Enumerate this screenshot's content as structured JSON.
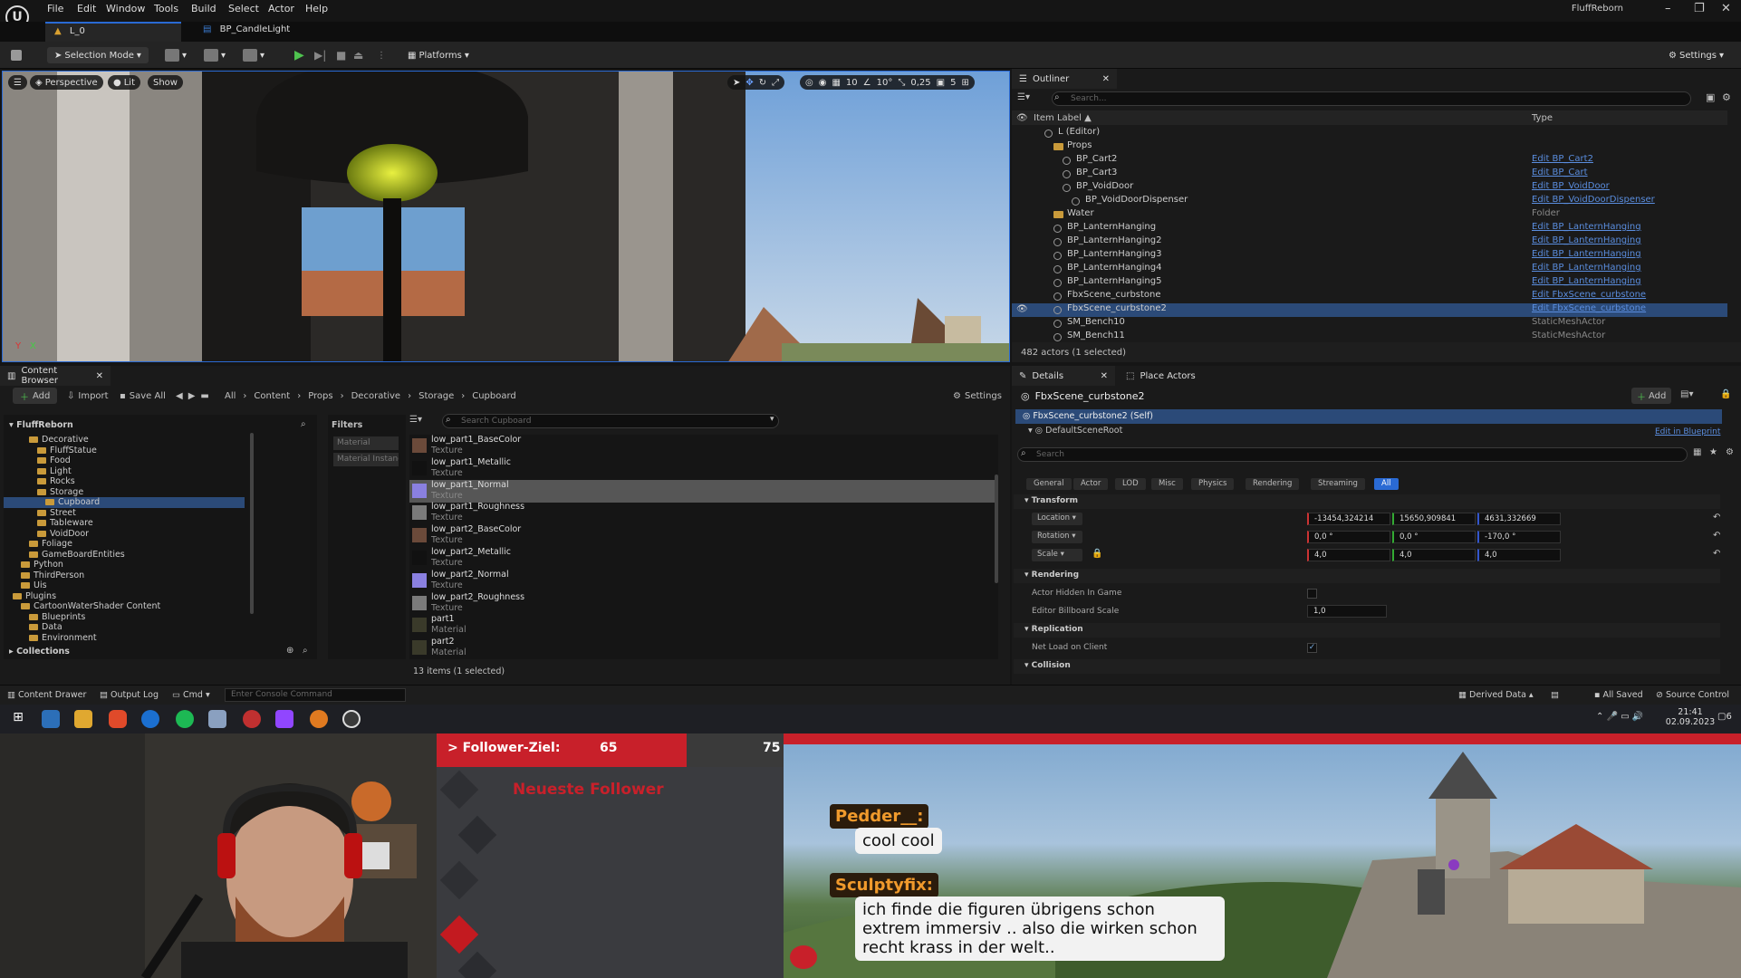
{
  "menubar": {
    "items": [
      "File",
      "Edit",
      "Window",
      "Tools",
      "Build",
      "Select",
      "Actor",
      "Help"
    ],
    "app_name": "FluffReborn"
  },
  "tabs": {
    "level": "L_0",
    "blueprint": "BP_CandleLight"
  },
  "toolbar": {
    "selection_mode": "Selection Mode",
    "platforms": "Platforms",
    "settings": "Settings"
  },
  "viewport": {
    "perspective": "Perspective",
    "lit": "Lit",
    "show": "Show",
    "grid_snap": "10",
    "rot_snap": "10°",
    "scale_snap": "0,25",
    "cam_speed": "5"
  },
  "outliner": {
    "tab": "Outliner",
    "search_placeholder": "Search...",
    "col_label": "Item Label ▲",
    "col_type": "Type",
    "rows": [
      {
        "label": "L (Editor)",
        "type": "",
        "indent": 2,
        "kind": "level"
      },
      {
        "label": "Props",
        "type": "",
        "indent": 3,
        "kind": "folder"
      },
      {
        "label": "BP_Cart2",
        "type": "Edit BP_Cart2",
        "indent": 4,
        "kind": "actor"
      },
      {
        "label": "BP_Cart3",
        "type": "Edit BP_Cart",
        "indent": 4,
        "kind": "actor"
      },
      {
        "label": "BP_VoidDoor",
        "type": "Edit BP_VoidDoor",
        "indent": 4,
        "kind": "actor"
      },
      {
        "label": "BP_VoidDoorDispenser",
        "type": "Edit BP_VoidDoorDispenser",
        "indent": 5,
        "kind": "actor"
      },
      {
        "label": "Water",
        "type": "Folder",
        "indent": 3,
        "kind": "folder"
      },
      {
        "label": "BP_LanternHanging",
        "type": "Edit BP_LanternHanging",
        "indent": 3,
        "kind": "actor"
      },
      {
        "label": "BP_LanternHanging2",
        "type": "Edit BP_LanternHanging",
        "indent": 3,
        "kind": "actor"
      },
      {
        "label": "BP_LanternHanging3",
        "type": "Edit BP_LanternHanging",
        "indent": 3,
        "kind": "actor"
      },
      {
        "label": "BP_LanternHanging4",
        "type": "Edit BP_LanternHanging",
        "indent": 3,
        "kind": "actor"
      },
      {
        "label": "BP_LanternHanging5",
        "type": "Edit BP_LanternHanging",
        "indent": 3,
        "kind": "actor"
      },
      {
        "label": "FbxScene_curbstone",
        "type": "Edit FbxScene_curbstone",
        "indent": 3,
        "kind": "actor"
      },
      {
        "label": "FbxScene_curbstone2",
        "type": "Edit FbxScene_curbstone",
        "indent": 3,
        "kind": "actor",
        "selected": true
      },
      {
        "label": "SM_Bench10",
        "type": "StaticMeshActor",
        "indent": 3,
        "kind": "actor"
      },
      {
        "label": "SM_Bench11",
        "type": "StaticMeshActor",
        "indent": 3,
        "kind": "actor"
      }
    ],
    "status": "482 actors (1 selected)"
  },
  "content_browser": {
    "tab": "Content Browser",
    "add": "Add",
    "import": "Import",
    "save_all": "Save All",
    "breadcrumb": [
      "All",
      "Content",
      "Props",
      "Decorative",
      "Storage",
      "Cupboard"
    ],
    "settings": "Settings",
    "root": "FluffReborn",
    "tree": [
      {
        "label": "Decorative",
        "indent": 2
      },
      {
        "label": "FluffStatue",
        "indent": 3
      },
      {
        "label": "Food",
        "indent": 3
      },
      {
        "label": "Light",
        "indent": 3
      },
      {
        "label": "Rocks",
        "indent": 3
      },
      {
        "label": "Storage",
        "indent": 3
      },
      {
        "label": "Cupboard",
        "indent": 4,
        "selected": true
      },
      {
        "label": "Street",
        "indent": 3
      },
      {
        "label": "Tableware",
        "indent": 3
      },
      {
        "label": "VoidDoor",
        "indent": 3
      },
      {
        "label": "Foliage",
        "indent": 2
      },
      {
        "label": "GameBoardEntities",
        "indent": 2
      },
      {
        "label": "Python",
        "indent": 1
      },
      {
        "label": "ThirdPerson",
        "indent": 1
      },
      {
        "label": "Uis",
        "indent": 1
      },
      {
        "label": "Plugins",
        "indent": 0
      },
      {
        "label": "CartoonWaterShader Content",
        "indent": 1
      },
      {
        "label": "Blueprints",
        "indent": 2
      },
      {
        "label": "Data",
        "indent": 2
      },
      {
        "label": "Environment",
        "indent": 2
      }
    ],
    "collections": "Collections",
    "filters_label": "Filters",
    "filters": [
      "Material",
      "Material Instanc"
    ],
    "search_placeholder": "Search Cupboard",
    "assets": [
      {
        "name": "low_part1_BaseColor",
        "type": "Texture",
        "color": "#6b4a3a"
      },
      {
        "name": "low_part1_Metallic",
        "type": "Texture",
        "color": "#111111"
      },
      {
        "name": "low_part1_Normal",
        "type": "Texture",
        "color": "#8a80e0",
        "selected": true
      },
      {
        "name": "low_part1_Roughness",
        "type": "Texture",
        "color": "#7a7a7a"
      },
      {
        "name": "low_part2_BaseColor",
        "type": "Texture",
        "color": "#6b4a3a"
      },
      {
        "name": "low_part2_Metallic",
        "type": "Texture",
        "color": "#111111"
      },
      {
        "name": "low_part2_Normal",
        "type": "Texture",
        "color": "#8a80e0"
      },
      {
        "name": "low_part2_Roughness",
        "type": "Texture",
        "color": "#7a7a7a"
      },
      {
        "name": "part1",
        "type": "Material",
        "color": "#3a3a2a"
      },
      {
        "name": "part2",
        "type": "Material",
        "color": "#3a3a2a"
      }
    ],
    "status": "13 items (1 selected)"
  },
  "details": {
    "tab": "Details",
    "tab2": "Place Actors",
    "actor": "FbxScene_curbstone2",
    "add": "Add",
    "self": "FbxScene_curbstone2 (Self)",
    "root": "DefaultSceneRoot",
    "edit_bp": "Edit in Blueprint",
    "search_placeholder": "Search",
    "categories": [
      "General",
      "Actor",
      "LOD",
      "Misc",
      "Physics",
      "Rendering",
      "Streaming",
      "All"
    ],
    "transform": "Transform",
    "location": "Location",
    "rotation": "Rotation",
    "scale": "Scale",
    "loc": [
      "-13454,324214",
      "15650,909841",
      "4631,332669"
    ],
    "rot": [
      "0,0 °",
      "0,0 °",
      "-170,0 °"
    ],
    "scl": [
      "4,0",
      "4,0",
      "4,0"
    ],
    "rendering": "Rendering",
    "hidden": "Actor Hidden In Game",
    "billboard": "Editor Billboard Scale",
    "billboard_val": "1,0",
    "replication": "Replication",
    "netload": "Net Load on Client",
    "collision": "Collision"
  },
  "bottombar": {
    "drawer": "Content Drawer",
    "outputlog": "Output Log",
    "cmd": "Cmd",
    "console_placeholder": "Enter Console Command",
    "derived": "Derived Data",
    "saved": "All Saved",
    "source": "Source Control"
  },
  "taskbar": {
    "time": "21:41",
    "date": "02.09.2023",
    "notif": "6"
  },
  "stream": {
    "goal_label": "> Follower-Ziel:",
    "goal_current": "65",
    "goal_target": "75",
    "goal_progress": 0.867,
    "latest_label": "Neueste Follower",
    "chat": [
      {
        "user": "Pedder__:",
        "msg": "cool cool"
      },
      {
        "user": "Sculptyfix:",
        "msg": "ich finde die figuren übrigens schon extrem immersiv .. also die wirken schon recht krass in der welt.."
      }
    ]
  },
  "colors": {
    "accent": "#2a6ad4",
    "selection": "#2b4a78",
    "goal_red": "#c8202a",
    "chat_name": "#f09a2c"
  }
}
